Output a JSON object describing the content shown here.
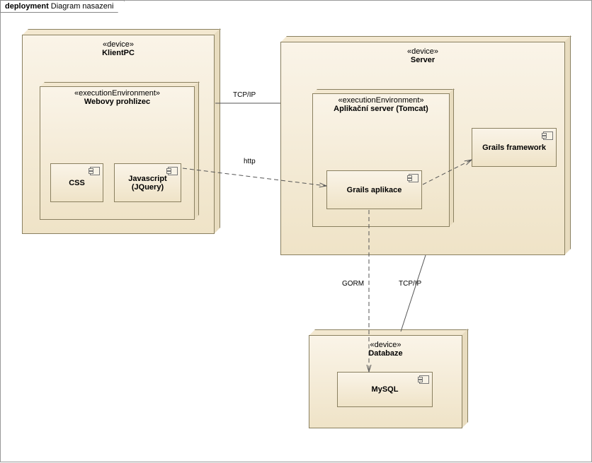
{
  "diagram": {
    "title_prefix": "deployment",
    "title_name": "Diagram nasazeni"
  },
  "nodes": {
    "client": {
      "stereotype": "«device»",
      "name": "KlientPC",
      "env": {
        "stereotype": "«executionEnvironment»",
        "name": "Webovy prohlizec",
        "components": {
          "css": "CSS",
          "js": "Javascript (JQuery)"
        }
      }
    },
    "server": {
      "stereotype": "«device»",
      "name": "Server",
      "env": {
        "stereotype": "«executionEnvironment»",
        "name": "Aplikační server (Tomcat)",
        "components": {
          "app": "Grails aplikace"
        }
      },
      "components": {
        "framework": "Grails framework"
      }
    },
    "db": {
      "stereotype": "«device»",
      "name": "Databaze",
      "components": {
        "mysql": "MySQL"
      }
    }
  },
  "connections": {
    "client_server": "TCP/IP",
    "http": "http",
    "gorm": "GORM",
    "server_db": "TCP/IP"
  }
}
